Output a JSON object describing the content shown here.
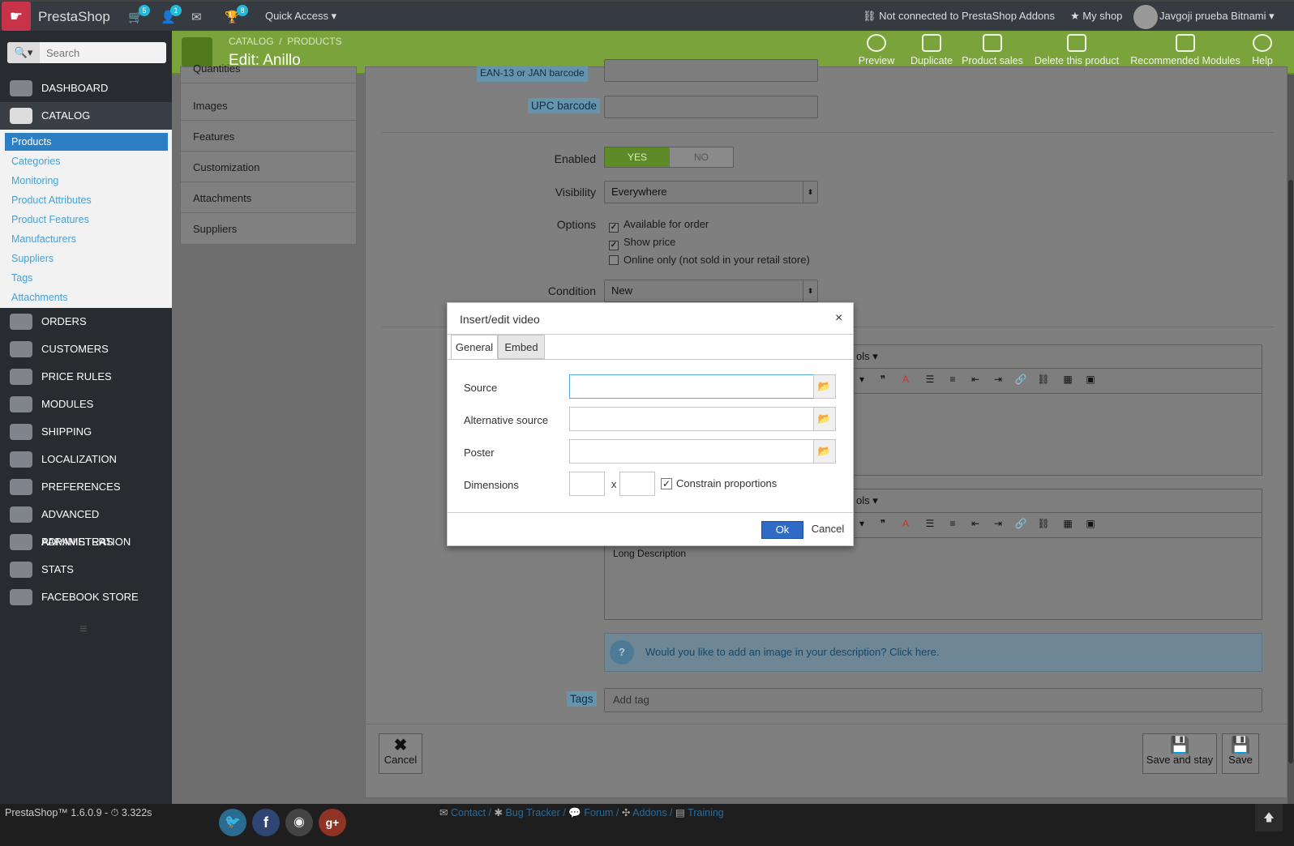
{
  "topbar": {
    "brand": "PrestaShop",
    "badges": {
      "cart": "5",
      "customers": "1",
      "trophy": "8"
    },
    "quick_access": "Quick Access",
    "addons_status": "Not connected to PrestaShop Addons",
    "my_shop": "My shop",
    "user": "Javgoji prueba Bitnami"
  },
  "sidebar": {
    "search_placeholder": "Search",
    "menu": [
      {
        "label": "DASHBOARD"
      },
      {
        "label": "CATALOG"
      },
      {
        "label": "ORDERS"
      },
      {
        "label": "CUSTOMERS"
      },
      {
        "label": "PRICE RULES"
      },
      {
        "label": "MODULES"
      },
      {
        "label": "SHIPPING"
      },
      {
        "label": "LOCALIZATION"
      },
      {
        "label": "PREFERENCES"
      },
      {
        "label": "ADVANCED PARAMETERS"
      },
      {
        "label": "ADMINISTRATION"
      },
      {
        "label": "STATS"
      },
      {
        "label": "FACEBOOK STORE"
      }
    ],
    "catalog_sub": [
      "Products",
      "Categories",
      "Monitoring",
      "Product Attributes",
      "Product Features",
      "Manufacturers",
      "Suppliers",
      "Tags",
      "Attachments"
    ]
  },
  "header": {
    "breadcrumb": [
      "CATALOG",
      "PRODUCTS"
    ],
    "title": "Edit: Anillo",
    "toolbar": [
      "Preview",
      "Duplicate",
      "Product sales",
      "Delete this product",
      "Recommended Modules",
      "Help"
    ]
  },
  "product_tabs": [
    "Quantities",
    "Images",
    "Features",
    "Customization",
    "Attachments",
    "Suppliers"
  ],
  "form": {
    "ean_label": "EAN-13 or JAN barcode",
    "upc_label": "UPC barcode",
    "enabled_label": "Enabled",
    "yes": "YES",
    "no": "NO",
    "visibility_label": "Visibility",
    "visibility_value": "Everywhere",
    "options_label": "Options",
    "options": [
      {
        "label": "Available for order",
        "checked": true
      },
      {
        "label": "Show price",
        "checked": true
      },
      {
        "label": "Online only (not sold in your retail store)",
        "checked": false
      }
    ],
    "condition_label": "Condition",
    "condition_value": "New",
    "tools_label": "ols",
    "long_description": "Long Description",
    "image_hint": "Would you like to add an image in your description? Click here.",
    "tags_label": "Tags",
    "tags_placeholder": "Add tag",
    "cancel": "Cancel",
    "save_and_stay": "Save and stay",
    "save": "Save"
  },
  "modal": {
    "title": "Insert/edit video",
    "close": "×",
    "tabs": [
      "General",
      "Embed"
    ],
    "source_label": "Source",
    "alt_source_label": "Alternative source",
    "poster_label": "Poster",
    "dimensions_label": "Dimensions",
    "dim_separator": "x",
    "constrain_label": "Constrain proportions",
    "ok": "Ok",
    "cancel": "Cancel"
  },
  "footer": {
    "version": "PrestaShop™ 1.6.0.9 -",
    "time": "3.322s",
    "links": [
      "Contact /",
      "Bug Tracker /",
      "Forum /",
      "Addons /",
      "Training"
    ]
  },
  "colors": {
    "topbar": "#363a41",
    "header_green": "#7aa33c",
    "link_blue": "#48a0d8",
    "ok_blue": "#2f6bc6"
  }
}
